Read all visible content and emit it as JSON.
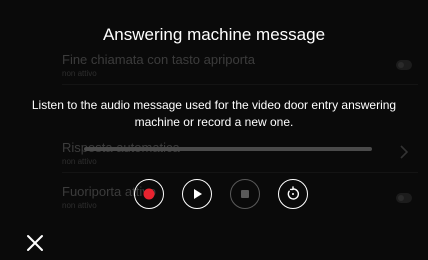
{
  "dialog": {
    "title": "Answering machine message",
    "description": "Listen to the audio message used for the video door entry answering machine or record a new one.",
    "progress_fraction": 0.0
  },
  "background_list": {
    "items": [
      {
        "title": "Fine chiamata con tasto apriporta",
        "status": "non attivo"
      },
      {
        "title": "Risposta automatica",
        "status": "non attivo"
      },
      {
        "title": "Fuoriporta attivo",
        "status": "non attivo"
      }
    ]
  },
  "controls": {
    "record": {
      "icon": "record-icon",
      "color": "#e8232f"
    },
    "play": {
      "icon": "play-icon"
    },
    "stop": {
      "icon": "stop-icon",
      "enabled": false
    },
    "reset": {
      "icon": "restore-icon"
    },
    "close": {
      "icon": "close-icon"
    }
  }
}
